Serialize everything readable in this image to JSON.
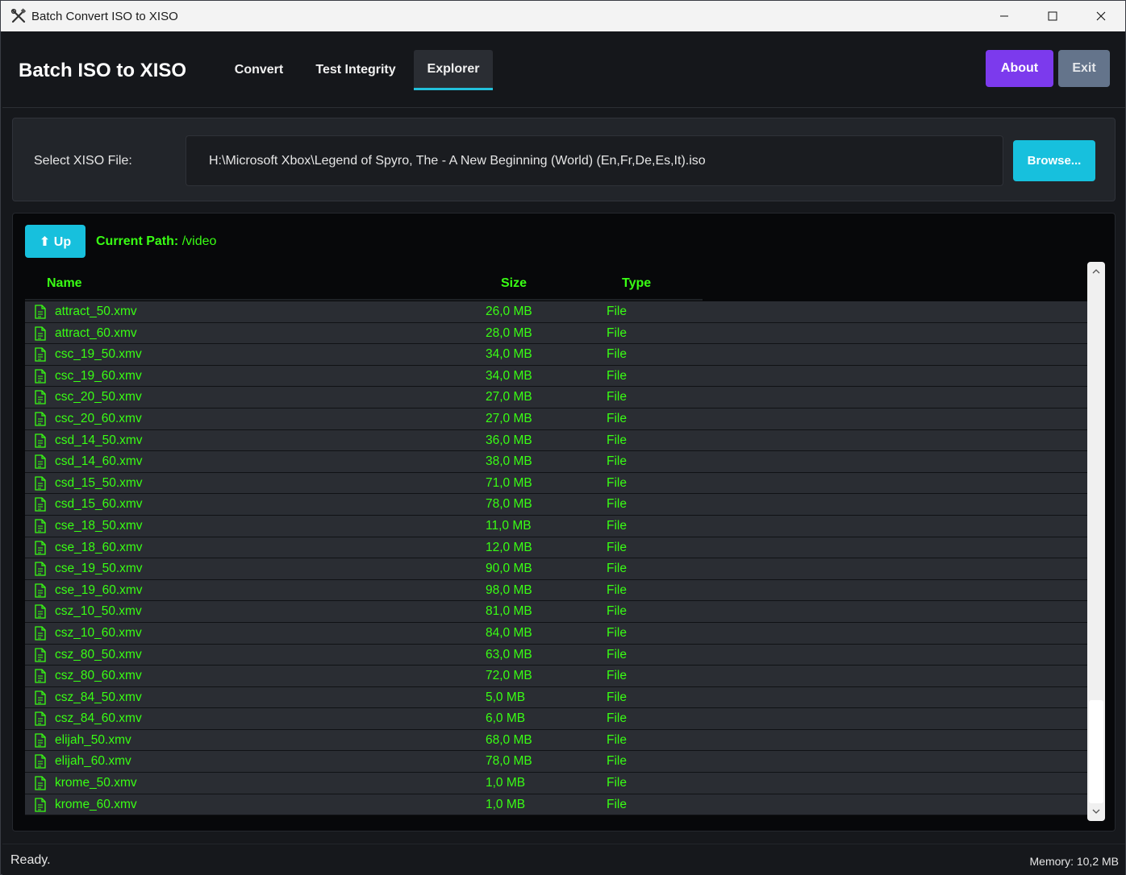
{
  "window": {
    "title": "Batch Convert ISO to XISO",
    "icon": "tools-icon"
  },
  "header": {
    "brand": "Batch ISO to XISO",
    "tabs": [
      {
        "label": "Convert",
        "active": false
      },
      {
        "label": "Test Integrity",
        "active": false
      },
      {
        "label": "Explorer",
        "active": true
      }
    ],
    "about_label": "About",
    "exit_label": "Exit"
  },
  "colors": {
    "about_bg": "#7c3aed",
    "exit_bg": "#64748b",
    "accent": "#17c0dd",
    "green_text": "#39ff14"
  },
  "select": {
    "label": "Select XISO File:",
    "value": "H:\\Microsoft Xbox\\Legend of Spyro, The - A New Beginning (World) (En,Fr,De,Es,It).iso",
    "browse_label": "Browse..."
  },
  "explorer": {
    "up_label": "⬆ Up",
    "path_label": "Current Path:",
    "path_value": "/video",
    "columns": [
      "Name",
      "Size",
      "Type"
    ],
    "rows": [
      {
        "name": "attract_50.xmv",
        "size": "26,0 MB",
        "type": "File"
      },
      {
        "name": "attract_60.xmv",
        "size": "28,0 MB",
        "type": "File"
      },
      {
        "name": "csc_19_50.xmv",
        "size": "34,0 MB",
        "type": "File"
      },
      {
        "name": "csc_19_60.xmv",
        "size": "34,0 MB",
        "type": "File"
      },
      {
        "name": "csc_20_50.xmv",
        "size": "27,0 MB",
        "type": "File"
      },
      {
        "name": "csc_20_60.xmv",
        "size": "27,0 MB",
        "type": "File"
      },
      {
        "name": "csd_14_50.xmv",
        "size": "36,0 MB",
        "type": "File"
      },
      {
        "name": "csd_14_60.xmv",
        "size": "38,0 MB",
        "type": "File"
      },
      {
        "name": "csd_15_50.xmv",
        "size": "71,0 MB",
        "type": "File"
      },
      {
        "name": "csd_15_60.xmv",
        "size": "78,0 MB",
        "type": "File"
      },
      {
        "name": "cse_18_50.xmv",
        "size": "11,0 MB",
        "type": "File"
      },
      {
        "name": "cse_18_60.xmv",
        "size": "12,0 MB",
        "type": "File"
      },
      {
        "name": "cse_19_50.xmv",
        "size": "90,0 MB",
        "type": "File"
      },
      {
        "name": "cse_19_60.xmv",
        "size": "98,0 MB",
        "type": "File"
      },
      {
        "name": "csz_10_50.xmv",
        "size": "81,0 MB",
        "type": "File"
      },
      {
        "name": "csz_10_60.xmv",
        "size": "84,0 MB",
        "type": "File"
      },
      {
        "name": "csz_80_50.xmv",
        "size": "63,0 MB",
        "type": "File"
      },
      {
        "name": "csz_80_60.xmv",
        "size": "72,0 MB",
        "type": "File"
      },
      {
        "name": "csz_84_50.xmv",
        "size": "5,0 MB",
        "type": "File"
      },
      {
        "name": "csz_84_60.xmv",
        "size": "6,0 MB",
        "type": "File"
      },
      {
        "name": "elijah_50.xmv",
        "size": "68,0 MB",
        "type": "File"
      },
      {
        "name": "elijah_60.xmv",
        "size": "78,0 MB",
        "type": "File"
      },
      {
        "name": "krome_50.xmv",
        "size": "1,0 MB",
        "type": "File"
      },
      {
        "name": "krome_60.xmv",
        "size": "1,0 MB",
        "type": "File"
      }
    ],
    "row_icon": "file-icon"
  },
  "status": {
    "text": "Ready.",
    "memory": "Memory: 10,2 MB"
  }
}
